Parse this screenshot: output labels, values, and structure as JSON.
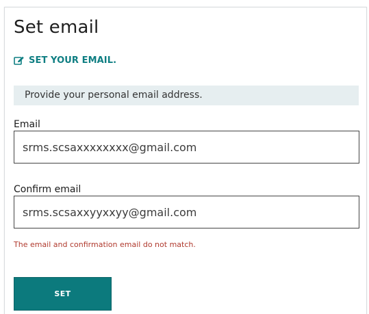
{
  "page": {
    "title": "Set email"
  },
  "section": {
    "heading": "SET YOUR EMAIL.",
    "icon": "edit-icon"
  },
  "banner": {
    "text": "Provide your personal email address."
  },
  "form": {
    "email_label": "Email",
    "email_value": "srms.scsaxxxxxxxx@gmail.com",
    "confirm_label": "Confirm email",
    "confirm_value": "srms.scsaxxyyxxyy@gmail.com",
    "error": "The email and confirmation email do not match.",
    "submit_label": "SET"
  },
  "colors": {
    "accent": "#0c7a7d",
    "error": "#b03a2e",
    "banner_bg": "#e6eef0"
  }
}
